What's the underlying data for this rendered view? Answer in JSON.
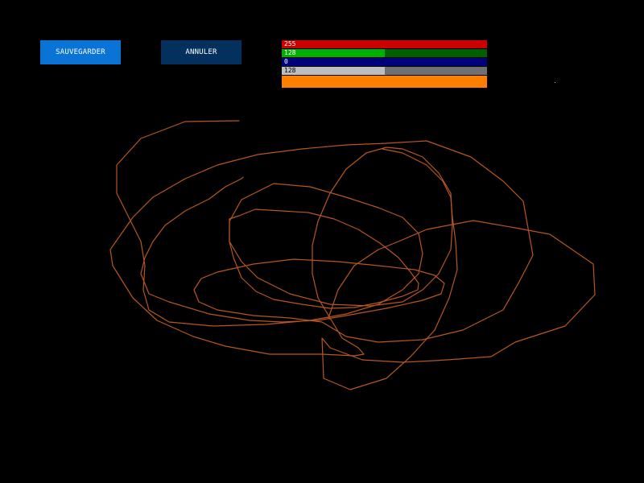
{
  "toolbar": {
    "save_label": "SAUVEGARDER",
    "cancel_label": "ANNULER"
  },
  "colors": {
    "background": "#000000",
    "save_button": "#0a74d6",
    "cancel_button": "#04305e",
    "stroke": "#b8561f",
    "preview": "#ff8000"
  },
  "color_picker": {
    "red": {
      "label": "255",
      "value": 255,
      "max": 255,
      "fill": "#cc0000",
      "track": "#cc0000"
    },
    "green": {
      "label": "128",
      "value": 128,
      "max": 255,
      "fill": "#00b000",
      "track": "#006000"
    },
    "blue": {
      "label": "0",
      "value": 0,
      "max": 255,
      "fill": "#0000ff",
      "track": "#00007a"
    },
    "alpha": {
      "label": "128",
      "value": 128,
      "max": 255,
      "fill": "#bdbdbd",
      "track": "#707070"
    }
  }
}
